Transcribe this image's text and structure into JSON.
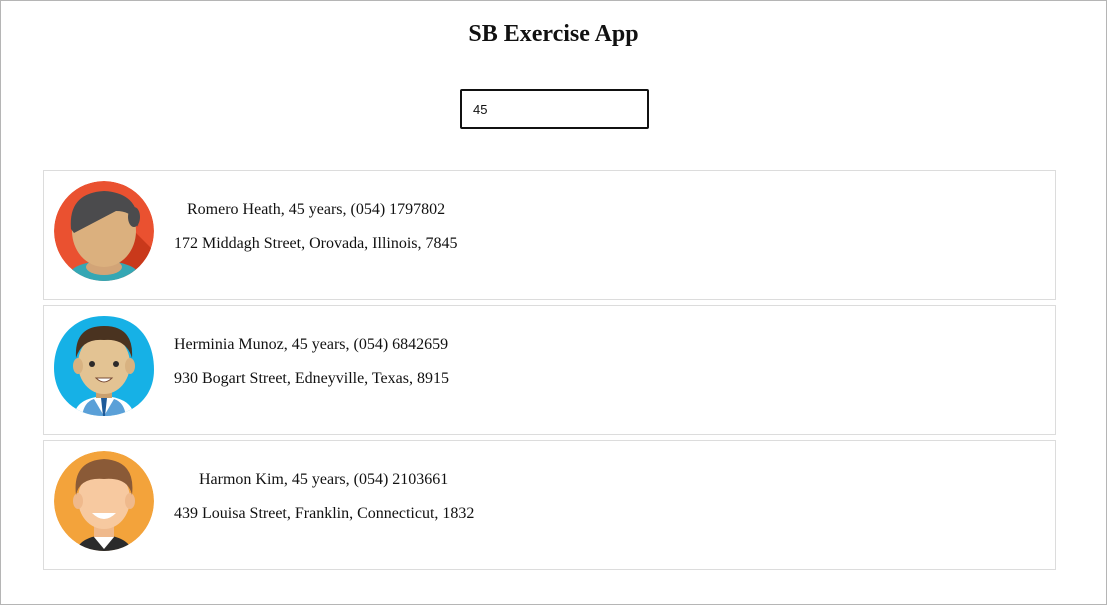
{
  "app": {
    "title": "SB Exercise App"
  },
  "search": {
    "value": "45"
  },
  "users": [
    {
      "summary": "Romero Heath, 45 years, (054) 1797802",
      "address": "172 Middagh Street, Orovada, Illinois, 7845",
      "avatar": "female-avatar-icon"
    },
    {
      "summary": "Herminia Munoz, 45 years, (054) 6842659",
      "address": "930 Bogart Street, Edneyville, Texas, 8915",
      "avatar": "male-avatar-icon"
    },
    {
      "summary": "Harmon Kim, 45 years, (054) 2103661",
      "address": "439 Louisa Street, Franklin, Connecticut, 1832",
      "avatar": "male-avatar-icon"
    }
  ],
  "colors": {
    "avatar_bg_1": "#ea5130",
    "avatar_bg_2": "#16b1e6",
    "avatar_bg_3": "#f3a33b"
  }
}
